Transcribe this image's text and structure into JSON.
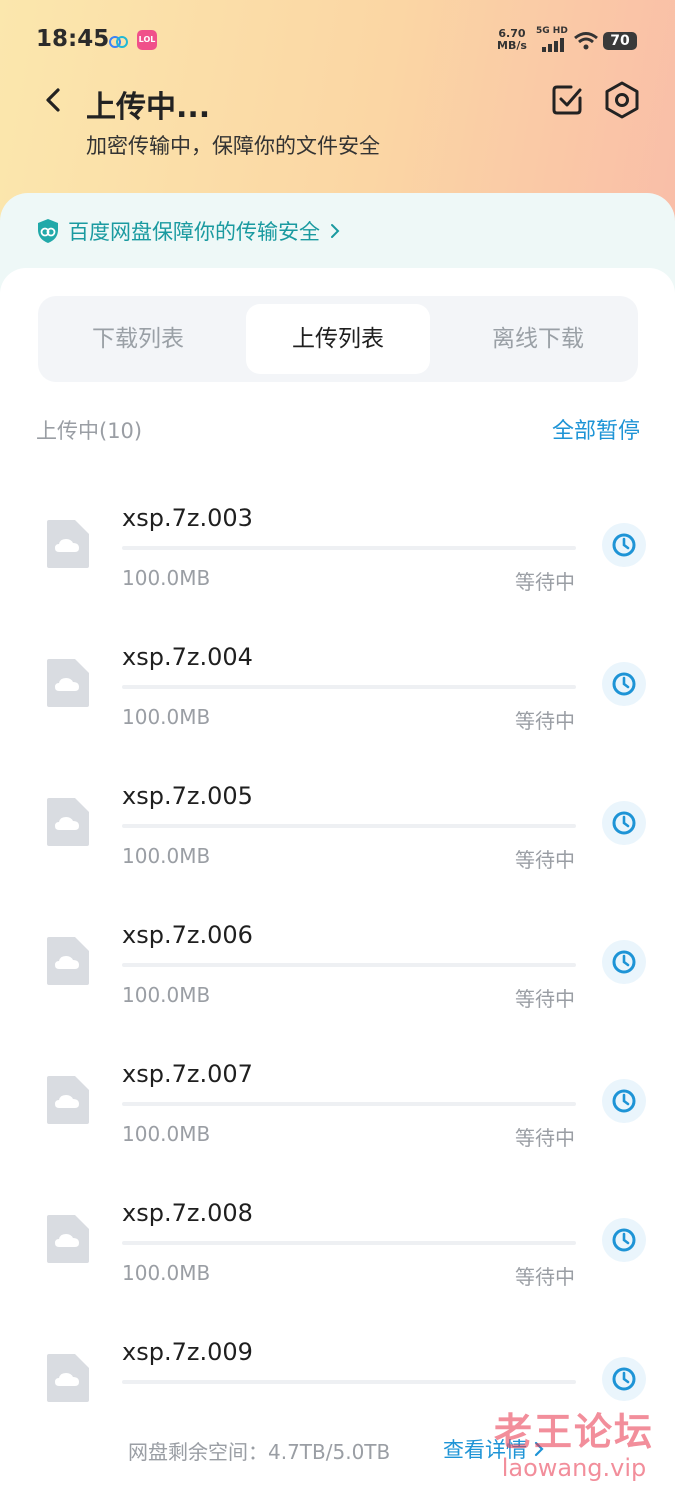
{
  "status_bar": {
    "time": "18:45",
    "app_badge": "LOL",
    "speed_value": "6.70",
    "speed_unit": "MB/s",
    "network": "5G HD",
    "battery": "70"
  },
  "header": {
    "title": "上传中...",
    "subtitle": "加密传输中，保障你的文件安全"
  },
  "security_banner": {
    "text": "百度网盘保障你的传输安全"
  },
  "tabs": [
    {
      "label": "下载列表",
      "active": false
    },
    {
      "label": "上传列表",
      "active": true
    },
    {
      "label": "离线下载",
      "active": false
    }
  ],
  "section": {
    "title": "上传中(10)",
    "action_label": "全部暂停"
  },
  "files": [
    {
      "name": "xsp.7z.003",
      "size": "100.0MB",
      "status": "等待中",
      "progress": 0
    },
    {
      "name": "xsp.7z.004",
      "size": "100.0MB",
      "status": "等待中",
      "progress": 0
    },
    {
      "name": "xsp.7z.005",
      "size": "100.0MB",
      "status": "等待中",
      "progress": 0
    },
    {
      "name": "xsp.7z.006",
      "size": "100.0MB",
      "status": "等待中",
      "progress": 0
    },
    {
      "name": "xsp.7z.007",
      "size": "100.0MB",
      "status": "等待中",
      "progress": 0
    },
    {
      "name": "xsp.7z.008",
      "size": "100.0MB",
      "status": "等待中",
      "progress": 0
    },
    {
      "name": "xsp.7z.009",
      "size": "",
      "status": "",
      "progress": 0
    }
  ],
  "footer": {
    "storage_text": "网盘剩余空间：4.7TB/5.0TB",
    "details_link": "查看详情"
  },
  "watermark": {
    "line1": "老王论坛",
    "line2": "laowang.vip"
  },
  "colors": {
    "accent": "#1e94d6",
    "security_green": "#1a9aa0"
  }
}
